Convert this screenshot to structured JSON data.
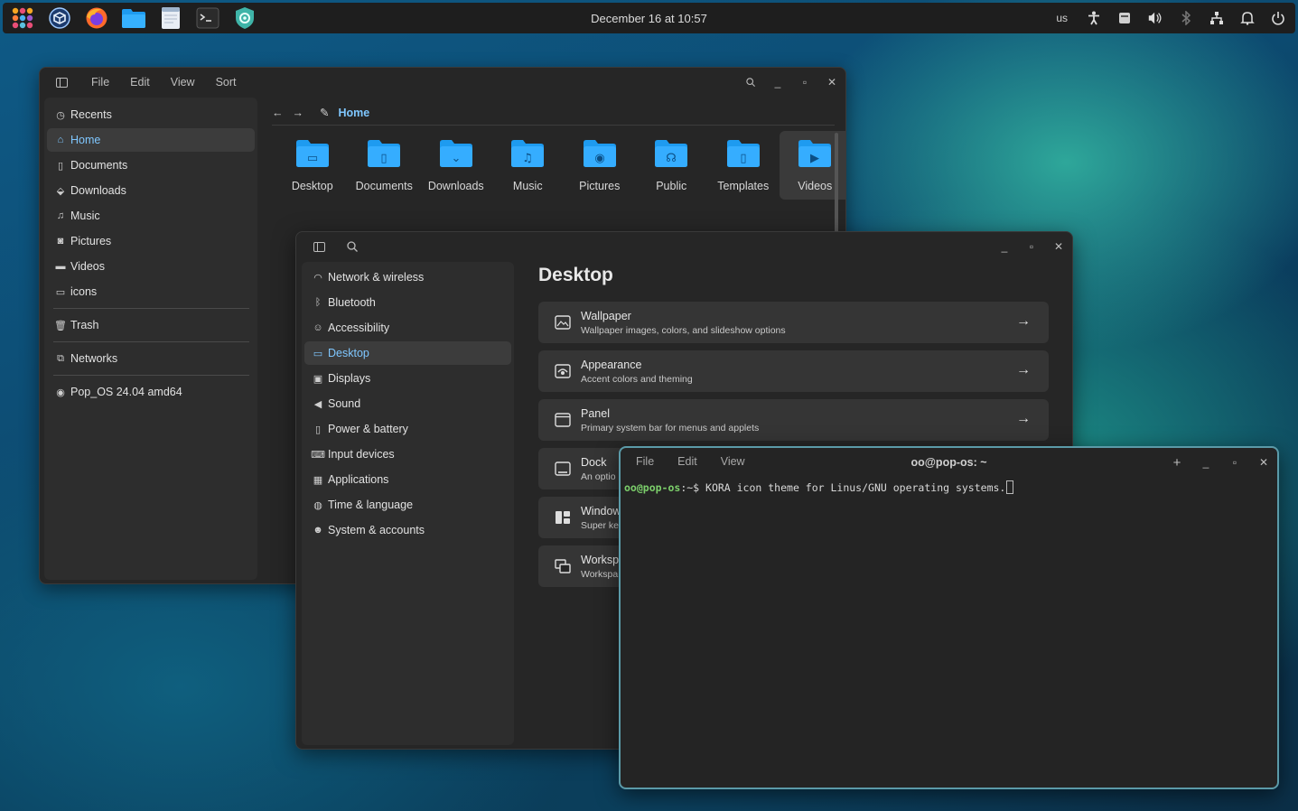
{
  "panel": {
    "clock": "December 16 at 10:57",
    "keyboard_layout": "us",
    "apps": [
      "app-launcher-icon",
      "cosmic-store-icon",
      "firefox-icon",
      "files-icon",
      "text-editor-icon",
      "terminal-icon",
      "settings-shield-icon"
    ]
  },
  "files": {
    "menu": [
      "File",
      "Edit",
      "View",
      "Sort"
    ],
    "path": "Home",
    "sidebar": [
      {
        "label": "Recents",
        "icon": "clock-icon"
      },
      {
        "label": "Home",
        "icon": "home-icon",
        "active": true
      },
      {
        "label": "Documents",
        "icon": "document-icon"
      },
      {
        "label": "Downloads",
        "icon": "download-icon"
      },
      {
        "label": "Music",
        "icon": "music-icon"
      },
      {
        "label": "Pictures",
        "icon": "camera-icon"
      },
      {
        "label": "Videos",
        "icon": "video-icon"
      },
      {
        "label": "icons",
        "icon": "folder-icon"
      },
      {
        "label": "Trash",
        "icon": "trash-icon"
      },
      {
        "label": "Networks",
        "icon": "network-icon"
      },
      {
        "label": "Pop_OS 24.04 amd64",
        "icon": "disc-icon"
      }
    ],
    "folders": [
      {
        "label": "Desktop",
        "glyph": "▭"
      },
      {
        "label": "Documents",
        "glyph": "▯"
      },
      {
        "label": "Downloads",
        "glyph": "⌄"
      },
      {
        "label": "Music",
        "glyph": "♫"
      },
      {
        "label": "Pictures",
        "glyph": "◉"
      },
      {
        "label": "Public",
        "glyph": "☊"
      },
      {
        "label": "Templates",
        "glyph": "▯"
      },
      {
        "label": "Videos",
        "glyph": "▶",
        "selected": true
      }
    ]
  },
  "settings": {
    "title": "Desktop",
    "sidebar": [
      {
        "label": "Network & wireless",
        "icon": "wifi-icon"
      },
      {
        "label": "Bluetooth",
        "icon": "bluetooth-icon"
      },
      {
        "label": "Accessibility",
        "icon": "accessibility-icon"
      },
      {
        "label": "Desktop",
        "icon": "desktop-icon",
        "active": true
      },
      {
        "label": "Displays",
        "icon": "display-icon"
      },
      {
        "label": "Sound",
        "icon": "speaker-icon"
      },
      {
        "label": "Power & battery",
        "icon": "battery-icon"
      },
      {
        "label": "Input devices",
        "icon": "keyboard-icon"
      },
      {
        "label": "Applications",
        "icon": "apps-grid-icon"
      },
      {
        "label": "Time & language",
        "icon": "globe-icon"
      },
      {
        "label": "System & accounts",
        "icon": "user-icon"
      }
    ],
    "cards": [
      {
        "title": "Wallpaper",
        "desc": "Wallpaper images, colors, and slideshow options",
        "icon": "wallpaper-icon"
      },
      {
        "title": "Appearance",
        "desc": "Accent colors and theming",
        "icon": "appearance-icon"
      },
      {
        "title": "Panel",
        "desc": "Primary system bar for menus and applets",
        "icon": "panel-icon"
      },
      {
        "title": "Dock",
        "desc": "An optio",
        "icon": "dock-icon"
      },
      {
        "title": "Window",
        "desc": "Super ke",
        "icon": "window-icon"
      },
      {
        "title": "Worksp",
        "desc": "Workspa",
        "icon": "workspaces-icon"
      }
    ]
  },
  "terminal": {
    "menu": [
      "File",
      "Edit",
      "View"
    ],
    "title": "oo@pop-os: ~",
    "prompt_user": "oo@pop-os",
    "prompt_rest": ":~$ ",
    "command": "KORA icon theme for Linus/GNU operating systems."
  },
  "colors": {
    "accent": "#7fc7ff",
    "folder_blue": "#1e9bf0",
    "terminal_border": "#5b9aa8",
    "prompt_green": "#7ccf6b"
  }
}
